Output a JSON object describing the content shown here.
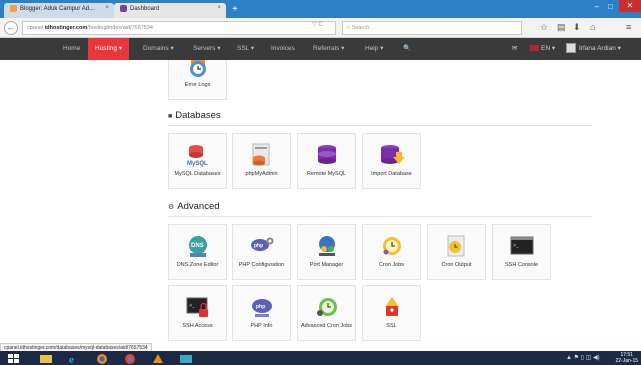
{
  "browser": {
    "tabs": [
      {
        "title": "Blogger: Aduk Campur Ad...",
        "color": "#f2a23a"
      },
      {
        "title": "Dashboard",
        "color": "#7a3fa0"
      }
    ],
    "new_tab": "+",
    "window_controls": {
      "minimize": "–",
      "maximize": "□",
      "close": "✕"
    },
    "back": "←",
    "address": {
      "prefix": "cpanel.",
      "domain": "idhostinger.com",
      "path": "/hosting/index/aid/7657534"
    },
    "reload": "▽ C",
    "search_placeholder": "Search",
    "toolbar_icons": [
      "star-icon",
      "bookmarks-icon",
      "download-icon",
      "home-icon",
      "menu-icon"
    ]
  },
  "nav": {
    "items": [
      {
        "label": "Home"
      },
      {
        "label": "Hosting ▾",
        "active": true
      },
      {
        "label": "Domains ▾"
      },
      {
        "label": "Servers ▾"
      },
      {
        "label": "SSL ▾"
      },
      {
        "label": "Invoices"
      },
      {
        "label": "Referrals ▾"
      },
      {
        "label": "Help ▾"
      }
    ],
    "search_icon": "🔍",
    "mail_icon": "✉",
    "language": "EN ▾",
    "user": "Irfana Ardian ▾"
  },
  "sections": [
    {
      "title": "",
      "cards": [
        {
          "label": "Error Logs",
          "icon": "error-logs-icon"
        }
      ]
    },
    {
      "title": "Databases",
      "symbol": "■",
      "cards": [
        {
          "label": "MySQL Databases",
          "icon": "mysql-icon"
        },
        {
          "label": "phpMyAdmin",
          "icon": "phpmyadmin-icon"
        },
        {
          "label": "Remote MySQL",
          "icon": "remote-mysql-icon"
        },
        {
          "label": "Import Database",
          "icon": "import-database-icon"
        }
      ]
    },
    {
      "title": "Advanced",
      "symbol": "⚙",
      "cards": [
        {
          "label": "DNS Zone Editor",
          "icon": "dns-icon"
        },
        {
          "label": "PHP Configuration",
          "icon": "php-config-icon"
        },
        {
          "label": "Port Manager",
          "icon": "port-manager-icon"
        },
        {
          "label": "Cron Jobs",
          "icon": "cron-jobs-icon"
        },
        {
          "label": "Cron Output",
          "icon": "cron-output-icon"
        },
        {
          "label": "SSH Console",
          "icon": "ssh-console-icon"
        },
        {
          "label": "SSH Access",
          "icon": "ssh-access-icon"
        },
        {
          "label": "PHP Info",
          "icon": "php-info-icon"
        },
        {
          "label": "Advanced Cron Jobs",
          "icon": "advanced-cron-icon"
        },
        {
          "label": "SSL",
          "icon": "ssl-icon"
        }
      ]
    }
  ],
  "status_url": "cpanel.idhostinger.com/databases/mysql-databases/aid/7657534",
  "clock": {
    "time": "17:51",
    "date": "22-Jan-15"
  },
  "colors": {
    "accent": "#e8363c",
    "navbar": "#3a3a3a",
    "titlebar": "#2b80c6",
    "taskbar": "#1b2a45"
  }
}
